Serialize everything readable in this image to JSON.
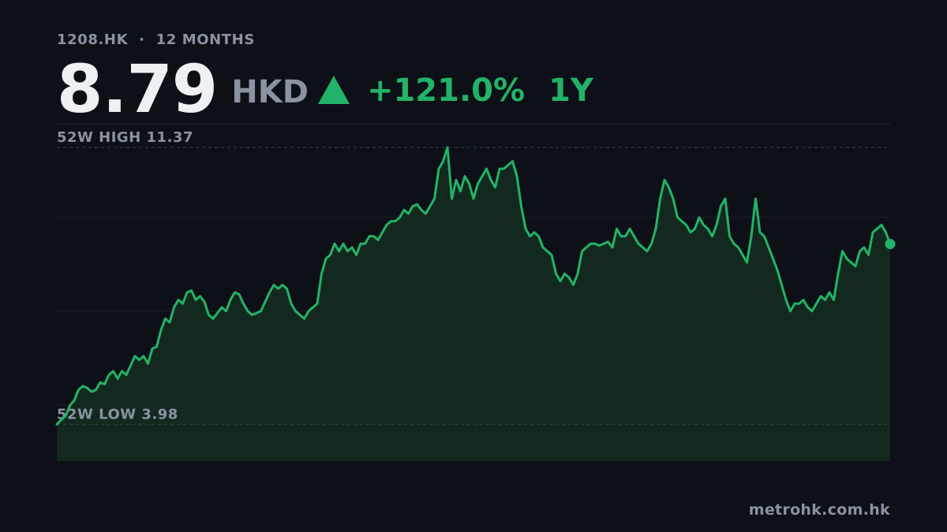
{
  "header": {
    "ticker": "1208.HK",
    "separator": "·",
    "range_label": "12 MONTHS",
    "price": "8.79",
    "currency": "HKD",
    "change": "+121.0%",
    "period": "1Y"
  },
  "footer": {
    "source": "metrohk.com.hk"
  },
  "colors": {
    "background": "#0d1017",
    "accent": "#22b368",
    "muted": "#8a93a2",
    "text": "#eef0f4"
  },
  "icons": {
    "change_direction": "triangle-up-icon"
  },
  "chart_data": {
    "type": "area",
    "title": "",
    "xlabel": "",
    "ylabel": "",
    "ylim": [
      3.0,
      12.0
    ],
    "grid": true,
    "reference_lines": [
      {
        "label": "52W HIGH",
        "value": "11.37"
      },
      {
        "label": "52W LOW",
        "value": "3.98"
      }
    ],
    "series": [
      {
        "values": [
          3.98,
          4.1,
          4.2,
          4.48,
          4.62,
          4.9,
          5.0,
          4.95,
          4.85,
          4.9,
          5.1,
          5.05,
          5.3,
          5.4,
          5.2,
          5.4,
          5.3,
          5.55,
          5.8,
          5.7,
          5.8,
          5.6,
          6.0,
          6.05,
          6.5,
          6.8,
          6.7,
          7.1,
          7.3,
          7.2,
          7.5,
          7.55,
          7.3,
          7.4,
          7.25,
          6.9,
          6.8,
          6.95,
          7.1,
          7.0,
          7.3,
          7.5,
          7.45,
          7.2,
          7.0,
          6.9,
          6.95,
          7.0,
          7.25,
          7.5,
          7.7,
          7.6,
          7.7,
          7.6,
          7.2,
          7.0,
          6.9,
          6.8,
          7.0,
          7.1,
          7.2,
          8.0,
          8.4,
          8.5,
          8.8,
          8.6,
          8.8,
          8.6,
          8.7,
          8.5,
          8.8,
          8.8,
          9.0,
          9.0,
          8.9,
          9.1,
          9.3,
          9.4,
          9.4,
          9.5,
          9.7,
          9.6,
          9.8,
          9.85,
          9.7,
          9.6,
          9.8,
          10.0,
          10.8,
          11.0,
          11.37,
          10.0,
          10.5,
          10.2,
          10.6,
          10.4,
          10.0,
          10.4,
          10.6,
          10.8,
          10.5,
          10.3,
          10.8,
          10.8,
          10.9,
          11.0,
          10.6,
          9.8,
          9.2,
          9.0,
          9.1,
          9.0,
          8.7,
          8.6,
          8.5,
          8.0,
          7.8,
          8.0,
          7.9,
          7.7,
          8.0,
          8.6,
          8.7,
          8.8,
          8.8,
          8.75,
          8.8,
          8.85,
          8.7,
          9.2,
          9.0,
          9.0,
          9.2,
          9.0,
          8.8,
          8.7,
          8.6,
          8.8,
          9.2,
          10.0,
          10.5,
          10.3,
          10.0,
          9.5,
          9.4,
          9.3,
          9.1,
          9.2,
          9.5,
          9.3,
          9.2,
          9.0,
          9.3,
          9.8,
          10.0,
          9.0,
          8.8,
          8.7,
          8.5,
          8.3,
          9.0,
          10.0,
          9.1,
          9.0,
          8.7,
          8.4,
          8.1,
          7.7,
          7.3,
          7.0,
          7.2,
          7.2,
          7.3,
          7.1,
          7.0,
          7.2,
          7.4,
          7.3,
          7.5,
          7.3,
          8.0,
          8.6,
          8.4,
          8.3,
          8.2,
          8.6,
          8.7,
          8.5,
          9.1,
          9.2,
          9.3,
          9.1,
          8.79
        ]
      }
    ]
  }
}
